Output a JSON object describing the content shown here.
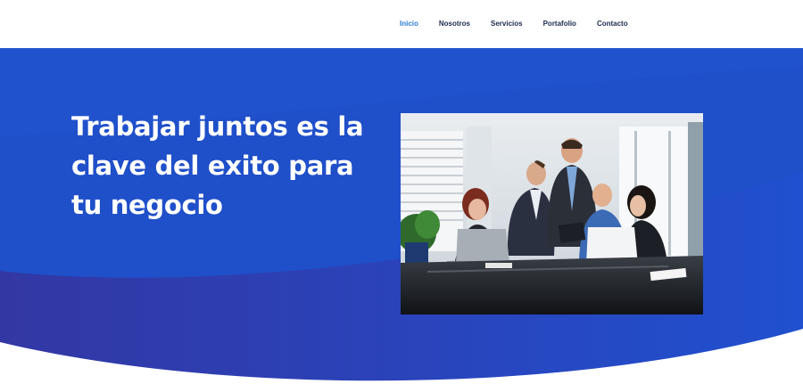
{
  "nav": {
    "items": [
      {
        "label": "Inicio",
        "active": true
      },
      {
        "label": "Nosotros",
        "active": false
      },
      {
        "label": "Servicios",
        "active": false
      },
      {
        "label": "Portafolio",
        "active": false
      },
      {
        "label": "Contacto",
        "active": false
      }
    ]
  },
  "hero": {
    "title": "Trabajar juntos es la clave del exito para tu negocio",
    "image_icon": "team-meeting-photo"
  },
  "colors": {
    "hero_blue": "#1f4fc9",
    "hero_deep": "#2b3aa6",
    "nav_text": "#1b2a4e",
    "nav_active": "#2a7bd6",
    "title_text": "#ffffff"
  }
}
